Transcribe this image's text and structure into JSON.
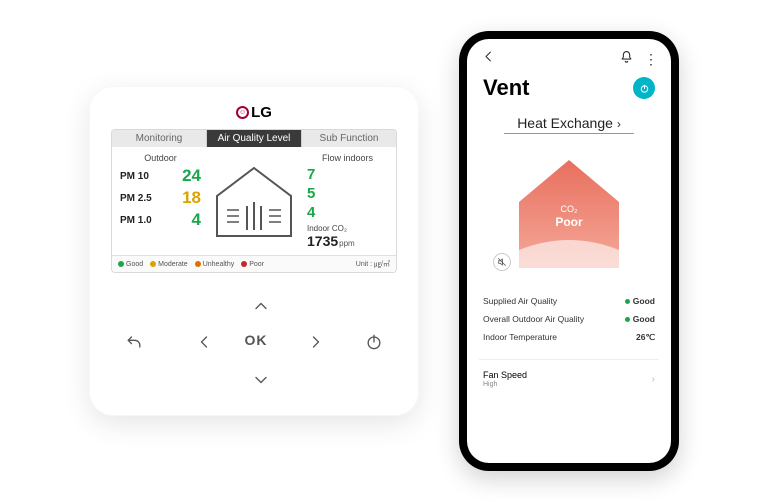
{
  "controller": {
    "brand": "LG",
    "tabs": {
      "monitoring": "Monitoring",
      "aql": "Air Quality Level",
      "sub": "Sub Function"
    },
    "sections": {
      "outdoor": "Outdoor",
      "flow": "Flow indoors"
    },
    "outdoor": {
      "pm10": {
        "label": "PM 10",
        "value": "24"
      },
      "pm25": {
        "label": "PM 2.5",
        "value": "18"
      },
      "pm1": {
        "label": "PM 1.0",
        "value": "4"
      }
    },
    "flow": {
      "v1": "7",
      "v2": "5",
      "v3": "4"
    },
    "co2": {
      "label": "Indoor CO₂",
      "value": "1735",
      "unit": "ppm"
    },
    "legend": {
      "good": "Good",
      "moderate": "Moderate",
      "unhealthy": "Unhealthy",
      "poor": "Poor",
      "unit": "Unit : ㎍/㎥"
    },
    "buttons": {
      "ok": "OK"
    }
  },
  "phone": {
    "title": "Vent",
    "mode": "Heat Exchange",
    "house": {
      "label": "CO₂",
      "quality": "Poor"
    },
    "rows": {
      "supplied": {
        "label": "Supplied Air Quality",
        "value": "Good"
      },
      "overall": {
        "label": "Overall Outdoor Air Quality",
        "value": "Good"
      },
      "temp": {
        "label": "Indoor Temperature",
        "value": "26℃"
      }
    },
    "fan": {
      "label": "Fan Speed",
      "value": "High"
    }
  }
}
